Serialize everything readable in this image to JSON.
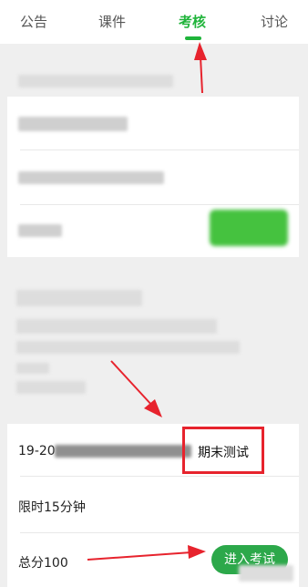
{
  "tabs": [
    {
      "label": "公告"
    },
    {
      "label": "课件"
    },
    {
      "label": "考核",
      "active": true
    },
    {
      "label": "讨论"
    }
  ],
  "exam": {
    "title_prefix": "19-20",
    "title": "期末测试",
    "time_limit": "限时15分钟",
    "total_score": "总分100",
    "enter_label": "进入考试"
  },
  "colors": {
    "accent": "#1fb43a",
    "button": "#2ca84a",
    "annotation": "#e7232d"
  }
}
